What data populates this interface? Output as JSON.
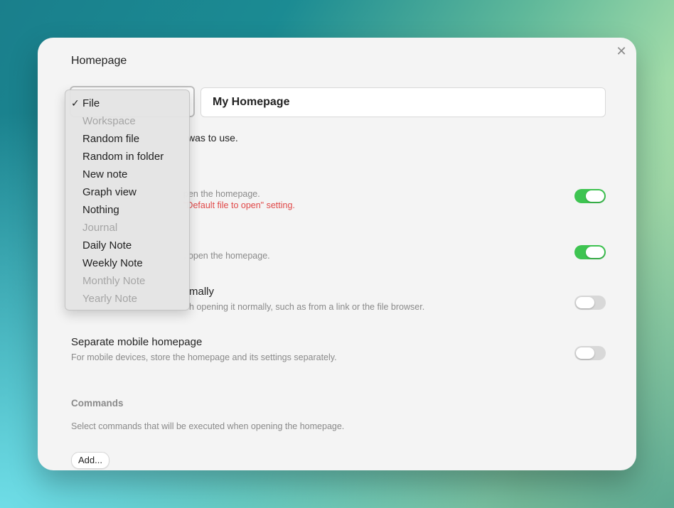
{
  "dialog": {
    "title": "Homepage",
    "close_icon": "close-icon",
    "homepage_input_value": "My Homepage",
    "partial_text": "was to use."
  },
  "dropdown": {
    "selected": "File",
    "check_mark": "✓",
    "items": [
      {
        "label": "File",
        "enabled": true
      },
      {
        "label": "Workspace",
        "enabled": false
      },
      {
        "label": "Random file",
        "enabled": true
      },
      {
        "label": "Random in folder",
        "enabled": true
      },
      {
        "label": "New note",
        "enabled": true
      },
      {
        "label": "Graph view",
        "enabled": true
      },
      {
        "label": "Nothing",
        "enabled": true
      },
      {
        "label": "Journal",
        "enabled": false
      },
      {
        "label": "Daily Note",
        "enabled": true
      },
      {
        "label": "Weekly Note",
        "enabled": true
      },
      {
        "label": "Monthly Note",
        "enabled": false
      },
      {
        "label": "Yearly Note",
        "enabled": false
      }
    ]
  },
  "settings": [
    {
      "name": "",
      "desc": "pen the homepage.",
      "warn": "\"Default file to open\" setting.",
      "toggle": true
    },
    {
      "name": "",
      "desc": ", open the homepage.",
      "toggle": true
    },
    {
      "name": "mally",
      "desc": "h opening it normally, such as from a link or the file browser.",
      "toggle": false
    },
    {
      "name": "Separate mobile homepage",
      "desc": "For mobile devices, store the homepage and its settings separately.",
      "toggle": false
    }
  ],
  "commands": {
    "header": "Commands",
    "desc": "Select commands that will be executed when opening the homepage.",
    "add_label": "Add..."
  },
  "colors": {
    "toggle_on": "#3ec451",
    "warning": "#e04848"
  }
}
